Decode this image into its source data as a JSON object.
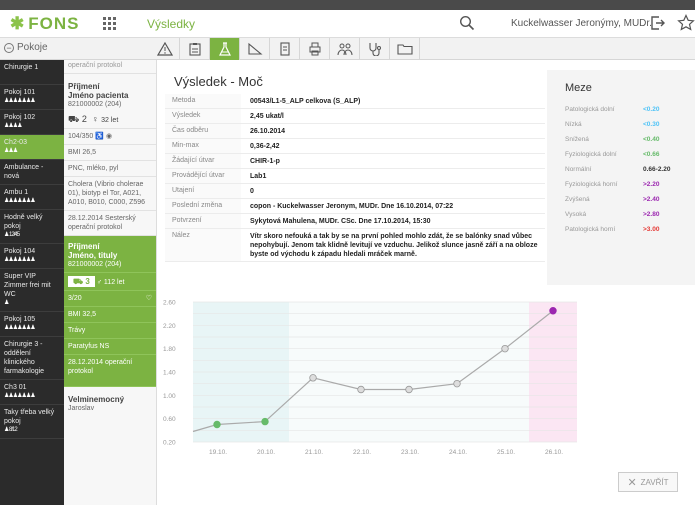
{
  "app": {
    "logo": "FONS",
    "nav_title": "Výsledky",
    "user": "Kuckelwasser Jeronýmy, MUDr."
  },
  "subbar": {
    "pokoje_label": "Pokoje"
  },
  "rooms": [
    {
      "name": "Chirurgie 1",
      "dots": ""
    },
    {
      "name": "Pokoj 101",
      "dots": "♟♟♟♟♟♟♟"
    },
    {
      "name": "Pokoj 102",
      "dots": "♟♟♟♟"
    },
    {
      "name": "Ch2-03",
      "dots": "♟♟♟",
      "active": true
    },
    {
      "name": "Ambulance - nová",
      "dots": ""
    },
    {
      "name": "Ambu 1",
      "dots": "♟♟♟♟♟♟♟"
    },
    {
      "name": "Hodně velký pokoj",
      "dots": "♟ 12/45"
    },
    {
      "name": "Pokoj 104",
      "dots": "♟♟♟♟♟♟♟"
    },
    {
      "name": "Super VIP Zimmer frei mit WC",
      "dots": "♟"
    },
    {
      "name": "Pokoj 105",
      "dots": "♟♟♟♟♟♟♟"
    },
    {
      "name": "Chirurgie 3 - oddělení klinického farmakologie",
      "dots": ""
    },
    {
      "name": "Ch3 01",
      "dots": "♟♟♟♟♟♟♟"
    },
    {
      "name": "Taky třeba velký pokoj",
      "dots": "♟ 8/12"
    }
  ],
  "patients": {
    "top_cut": "operační protokol",
    "p1": {
      "title": "Příjmení\nJméno pacienta",
      "id": "821000002 (204)",
      "bed": "2",
      "age": "32 let",
      "stats": "104/350",
      "bmi": "BMI 26,5",
      "diet": "PNC, mléko, pyl",
      "diag": "Cholera (Vibrio cholerae 01), biotyp el Tor, A021, A010, B010, C000, Z596",
      "protocol": "28.12.2014 Sesterský operační protokol"
    },
    "p2": {
      "title": "Příjmení\nJméno, tituly",
      "id": "821000002 (204)",
      "bed": "3",
      "age": "112 let",
      "stats": "3/20",
      "bmi": "BMI 32,5",
      "diet": "Trávy",
      "diag": "Paratyfus NS",
      "protocol": "28.12.2014 operační protokol"
    },
    "p3": {
      "title": "Velminemocný",
      "sub": "Jaroslav"
    }
  },
  "result": {
    "title": "Výsledek - Moč",
    "rows": [
      {
        "label": "Metoda",
        "value": "00543/L1-5_ALP celkova (S_ALP)"
      },
      {
        "label": "Výsledek",
        "value": "2,45 ukat/l"
      },
      {
        "label": "Čas odběru",
        "value": "26.10.2014"
      },
      {
        "label": "Min-max",
        "value": "0,36-2,42"
      },
      {
        "label": "Žádající útvar",
        "value": "CHIR-1-p"
      },
      {
        "label": "Provádějící útvar",
        "value": "Lab1"
      },
      {
        "label": "Utajení",
        "value": "0"
      },
      {
        "label": "Poslední změna",
        "value": "copon - Kuckelwasser Jeronym, MUDr.  Dne 16.10.2014, 07:22"
      },
      {
        "label": "Potvrzení",
        "value": "Sykytová Mahulena, MUDr. CSc.  Dne 17.10.2014, 15:30"
      },
      {
        "label": "Nález",
        "value": "Vítr skoro nefouká a tak by se na první pohled mohlo zdát, že se balónky snad vůbec nepohybují. Jenom tak klidně levitují ve vzduchu. Jelikož slunce jasně září a na obloze byste od východu k západu hledali mráček marně."
      }
    ]
  },
  "limits": {
    "title": "Meze",
    "rows": [
      {
        "label": "Patologická dolní",
        "value": "<0.20",
        "color": "#4fc3f7"
      },
      {
        "label": "Nízká",
        "value": "<0.30",
        "color": "#4fc3f7"
      },
      {
        "label": "Snížená",
        "value": "<0.40",
        "color": "#66bb6a"
      },
      {
        "label": "Fyziologická dolní",
        "value": "<0.66",
        "color": "#66bb6a"
      },
      {
        "label": "Normální",
        "value": "0.66-2.20",
        "color": "#333333"
      },
      {
        "label": "Fyziologická horní",
        "value": ">2.20",
        "color": "#9c27b0"
      },
      {
        "label": "Zvýšená",
        "value": ">2.40",
        "color": "#9c27b0"
      },
      {
        "label": "Vysoká",
        "value": ">2.80",
        "color": "#9c27b0"
      },
      {
        "label": "Patologická horní",
        "value": ">3.00",
        "color": "#e53935"
      }
    ]
  },
  "close_label": "ZAVŘÍT",
  "chart_data": {
    "type": "line",
    "categories": [
      "19.10.",
      "20.10.",
      "21.10.",
      "22.10.",
      "23.10.",
      "24.10.",
      "25.10.",
      "26.10."
    ],
    "x": [
      0.5,
      1.5,
      2.5,
      3.5,
      4.5,
      5.5,
      6.5,
      7.5
    ],
    "values": [
      0.5,
      0.55,
      1.3,
      1.1,
      1.1,
      1.2,
      1.8,
      2.45
    ],
    "ylim": [
      0.2,
      2.6
    ],
    "yticks": [
      "0.20",
      "0.40",
      "0.60",
      "0.80",
      "1.00",
      "1.20",
      "1.40",
      "1.60",
      "1.80",
      "2.00",
      "2.20",
      "2.40",
      "2.60"
    ],
    "ytick_labels": [
      "2.60",
      "2.20",
      "1.80",
      "1.40",
      "1.00",
      "0.60",
      "0.20"
    ],
    "point_colors": [
      "#66bb6a",
      "#66bb6a",
      "#dddddd",
      "#dddddd",
      "#dddddd",
      "#dddddd",
      "#dddddd",
      "#9c27b0"
    ],
    "bands": [
      {
        "x_from": 0,
        "x_to": 2,
        "color": "#e8f5f6"
      },
      {
        "x_from": 7,
        "x_to": 8,
        "color": "#fbe6f3"
      }
    ],
    "grid": true
  }
}
